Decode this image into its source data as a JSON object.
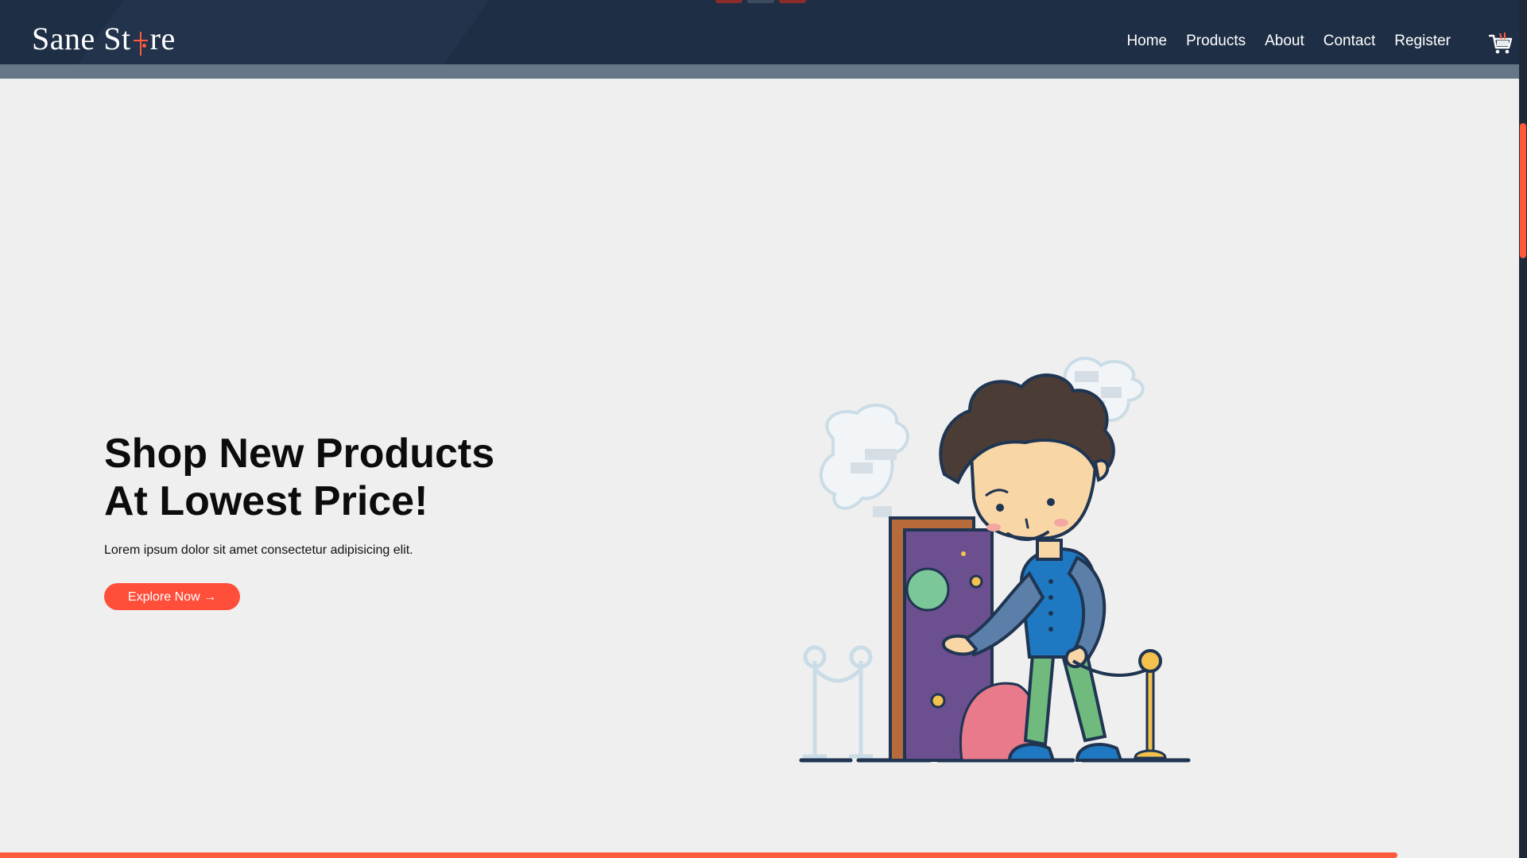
{
  "brand": {
    "logo_text_before": "Sane St",
    "logo_text_after": "re",
    "accent": "#ff5a3c",
    "header_bg": "#1e2f45",
    "page_bg": "#efefef"
  },
  "nav": {
    "items": [
      {
        "label": "Home"
      },
      {
        "label": "Products"
      },
      {
        "label": "About"
      },
      {
        "label": "Contact"
      },
      {
        "label": "Register"
      }
    ],
    "cart_icon": "shopping-cart-icon"
  },
  "hero": {
    "title_line1": "Shop New Products",
    "title_line2": "At Lowest Price!",
    "subtitle": "Lorem ipsum dolor sit amet consectetur adipisicing elit.",
    "cta_label": "Explore Now →"
  },
  "scroll_progress": 0.92
}
